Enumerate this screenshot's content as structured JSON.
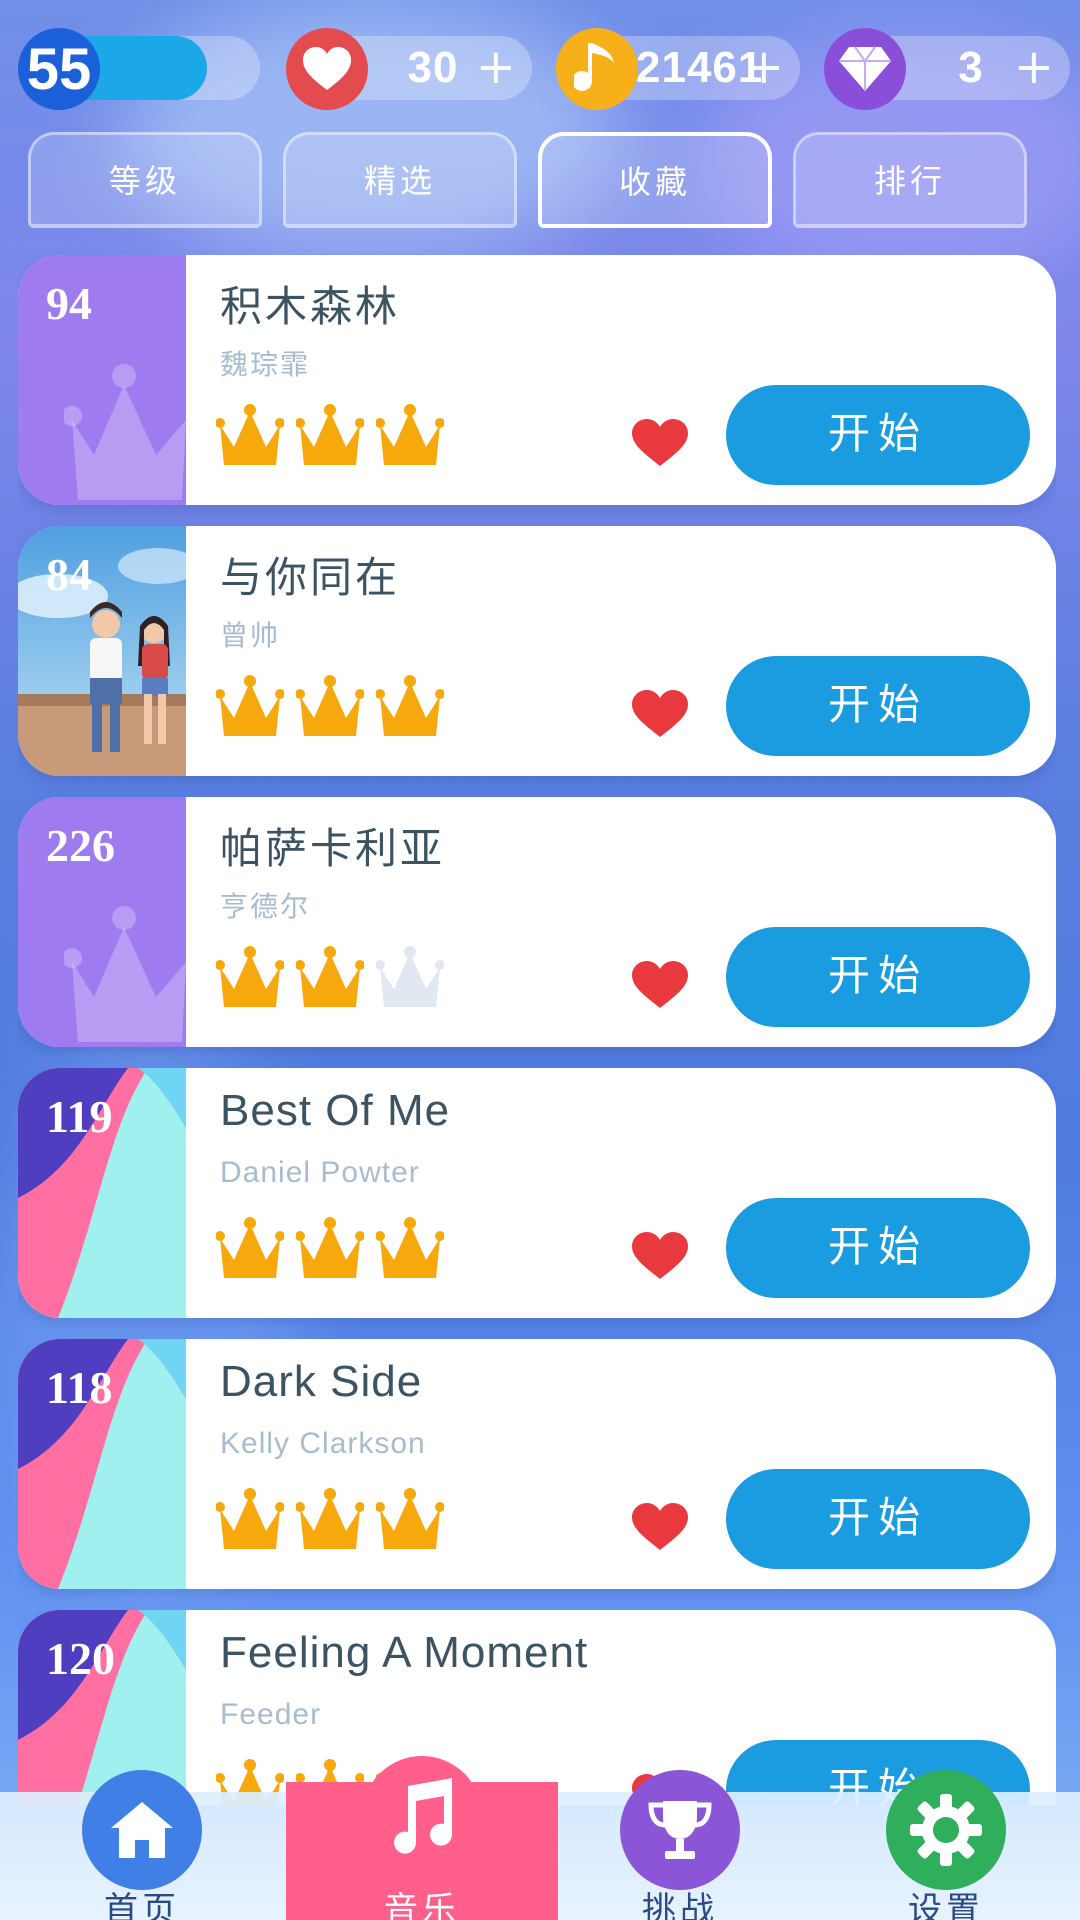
{
  "status": {
    "level": "55",
    "level_progress": 0.78,
    "lives": "30",
    "notes": "21461",
    "gems": "3",
    "plus": "+"
  },
  "tabs": [
    {
      "label": "等级",
      "active": false
    },
    {
      "label": "精选",
      "active": false
    },
    {
      "label": "收藏",
      "active": true
    },
    {
      "label": "排行",
      "active": false
    }
  ],
  "songs": [
    {
      "number": "94",
      "title": "积木森林",
      "artist": "魏琮霏",
      "crowns": 3,
      "favorite": true,
      "start_label": "开始",
      "cover": "purple-crown"
    },
    {
      "number": "84",
      "title": "与你同在",
      "artist": "曾帅",
      "crowns": 3,
      "favorite": true,
      "start_label": "开始",
      "cover": "couple-illustration"
    },
    {
      "number": "226",
      "title": "帕萨卡利亚",
      "artist": "亨德尔",
      "crowns": 2,
      "favorite": true,
      "start_label": "开始",
      "cover": "purple-crown"
    },
    {
      "number": "119",
      "title": "Best Of Me",
      "artist": "Daniel Powter",
      "crowns": 3,
      "favorite": true,
      "start_label": "开始",
      "cover": "pink-waves"
    },
    {
      "number": "118",
      "title": "Dark Side",
      "artist": "Kelly Clarkson",
      "crowns": 3,
      "favorite": true,
      "start_label": "开始",
      "cover": "pink-waves"
    },
    {
      "number": "120",
      "title": "Feeling A Moment",
      "artist": "Feeder",
      "crowns": 3,
      "favorite": true,
      "start_label": "开始",
      "cover": "pink-waves"
    }
  ],
  "nav": [
    {
      "label": "首页",
      "icon": "home-icon",
      "color": "#3f7fe6",
      "active": false
    },
    {
      "label": "音乐",
      "icon": "music-note-icon",
      "color": "#ff5f8a",
      "active": true
    },
    {
      "label": "挑战",
      "icon": "trophy-icon",
      "color": "#8a55d6",
      "active": false
    },
    {
      "label": "设置",
      "icon": "gear-icon",
      "color": "#2fae5c",
      "active": false
    }
  ],
  "colors": {
    "accent_blue": "#1b9be0",
    "crown_gold": "#f6a80c",
    "crown_empty": "#e1e8f1",
    "heart_red": "#e83a3e",
    "title_text": "#3c5364",
    "artist_text": "#a8bccf"
  }
}
